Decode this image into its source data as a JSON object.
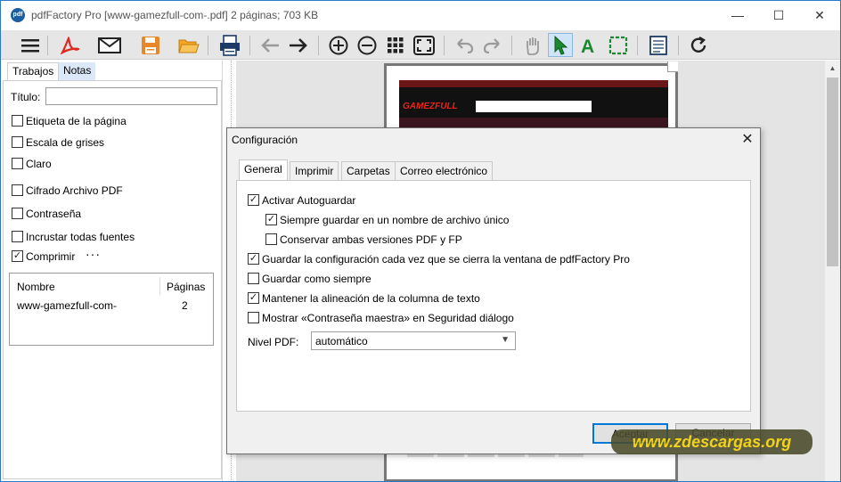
{
  "window": {
    "title": "pdfFactory Pro [www-gamezfull-com-.pdf] 2 páginas; 703 KB",
    "icon_text": "pdf"
  },
  "toolbar": {
    "items": [
      "menu-icon",
      "pdf-icon",
      "email-icon",
      "save-icon",
      "open-folder-icon",
      "print-icon",
      "back-arrow-icon",
      "forward-arrow-icon",
      "zoom-in-icon",
      "zoom-out-icon",
      "thumbnails-icon",
      "fit-page-icon",
      "undo-icon",
      "redo-icon",
      "hand-tool-icon",
      "select-arrow-icon",
      "text-tool-icon",
      "select-area-icon",
      "notes-icon",
      "refresh-icon"
    ]
  },
  "left_panel": {
    "tabs": [
      "Trabajos",
      "Notas"
    ],
    "title_label": "Título:",
    "title_value": "",
    "options": [
      {
        "label": "Etiqueta de la página",
        "checked": false
      },
      {
        "label": "Escala de grises",
        "checked": false
      },
      {
        "label": "Claro",
        "checked": false
      },
      {
        "label": "Cifrado Archivo PDF",
        "checked": false
      },
      {
        "label": "Contraseña",
        "checked": false
      },
      {
        "label": "Incrustar todas fuentes",
        "checked": false
      },
      {
        "label": "Comprimir",
        "checked": true
      }
    ],
    "more_label": "···",
    "table": {
      "headers": [
        "Nombre",
        "Páginas"
      ],
      "rows": [
        [
          "www-gamezfull-com-",
          "2"
        ]
      ]
    }
  },
  "preview": {
    "site_logo": "GAMEZFULL"
  },
  "dialog": {
    "title": "Configuración",
    "close": "✕",
    "tabs": [
      "General",
      "Imprimir",
      "Carpetas",
      "Correo electrónico"
    ],
    "active_tab": "General",
    "options": [
      {
        "label": "Activar Autoguardar",
        "checked": true,
        "indent": 0
      },
      {
        "label": "Siempre guardar en un nombre de archivo único",
        "checked": true,
        "indent": 1
      },
      {
        "label": "Conservar ambas versiones PDF y FP",
        "checked": false,
        "indent": 1
      },
      {
        "label": "Guardar la configuración cada vez que se cierra la ventana de pdfFactory Pro",
        "checked": true,
        "indent": 0
      },
      {
        "label": "Guardar como siempre",
        "checked": false,
        "indent": 0
      },
      {
        "label": "Mantener la alineación de la columna de texto",
        "checked": true,
        "indent": 0
      },
      {
        "label": "Mostrar «Contraseña maestra» en Seguridad diálogo",
        "checked": false,
        "indent": 0
      }
    ],
    "pdf_level_label": "Nivel PDF:",
    "pdf_level_value": "automático",
    "ok_label": "Aceptar",
    "cancel_label": "Cancelar"
  },
  "watermark": "www.zdescargas.org",
  "colors": {
    "accent": "#0078d7",
    "pdf_red": "#e1261c",
    "save_orange": "#e8862a",
    "select_green": "#1b8a2e"
  }
}
